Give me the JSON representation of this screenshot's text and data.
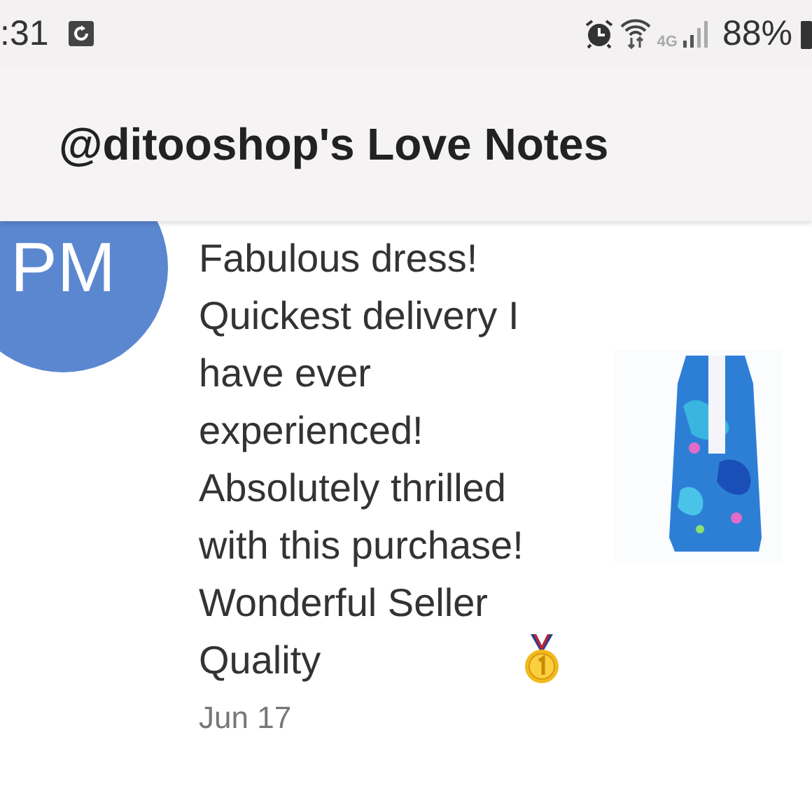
{
  "status_bar": {
    "time": ":31",
    "network": "4G",
    "battery": "88%"
  },
  "header": {
    "title": "@ditooshop's Love Notes"
  },
  "note": {
    "avatar": "PM",
    "message": "Fabulous dress!\nQuickest delivery I\nhave ever\nexperienced!\nAbsolutely thrilled\nwith this purchase!\nWonderful Seller\nQuality",
    "date": "Jun 17"
  }
}
